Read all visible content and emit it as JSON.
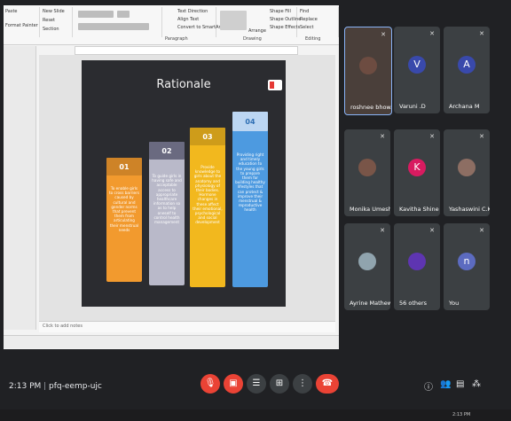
{
  "ppt": {
    "ribbon_labels": [
      "Paragraph",
      "Drawing",
      "Editing"
    ],
    "ribbon_texts": [
      "Shape Fill",
      "Shape Outline",
      "Shape Effects",
      "Find",
      "Replace",
      "Select",
      "Text Direction",
      "Align Text",
      "Convert to SmartArt",
      "Arrange",
      "Quick Styles",
      "Paste",
      "New Slide",
      "Reset",
      "Section",
      "Format Painter"
    ],
    "notes_placeholder": "Click to add notes"
  },
  "slide": {
    "title": "Rationale",
    "cards": [
      {
        "num": "01",
        "color": "#f29a2e",
        "text": "To enable girls to cross barriers caused by cultural and gender norms that prevent them from articulating their menstrual needs"
      },
      {
        "num": "02",
        "color": "#b9b9c9",
        "text": "To guide girls in having safe and acceptable access to appropriate healthcare information so as to help oneself to control health management"
      },
      {
        "num": "03",
        "color": "#f2b81e",
        "text": "Provide knowledge to girls about the anatomy and physiology of their bodies. Hormone changes in these affect their emotional, psychological and social development"
      },
      {
        "num": "04",
        "color": "#4d9ae0",
        "text": "Providing right and timely education to the young girls to prepare them for building healthy lifestyles that can protect & improve their menstrual & reproductive health"
      }
    ]
  },
  "participants": [
    {
      "name": "roshnee bhow...",
      "initial": "",
      "color": "#6d4c41"
    },
    {
      "name": "Varuni .D",
      "initial": "V",
      "color": "#3949ab"
    },
    {
      "name": "Archana M",
      "initial": "A",
      "color": "#3949ab"
    },
    {
      "name": "Monika Umesh",
      "initial": "",
      "color": "#795548"
    },
    {
      "name": "Kavitha Shine",
      "initial": "K",
      "color": "#d81b60"
    },
    {
      "name": "Yashaswini C.K",
      "initial": "",
      "color": "#8d6e63"
    },
    {
      "name": "Ayrine Mathew",
      "initial": "",
      "color": "#90a4ae"
    },
    {
      "name": "56 others",
      "initial": "",
      "color": "#5e35b1"
    },
    {
      "name": "You",
      "initial": "n",
      "color": "#5c6bc0"
    }
  ],
  "meeting": {
    "time": "2:13 PM",
    "code": "pfq-eemp-ujc"
  },
  "taskbar": {
    "time": "2:13 PM"
  }
}
